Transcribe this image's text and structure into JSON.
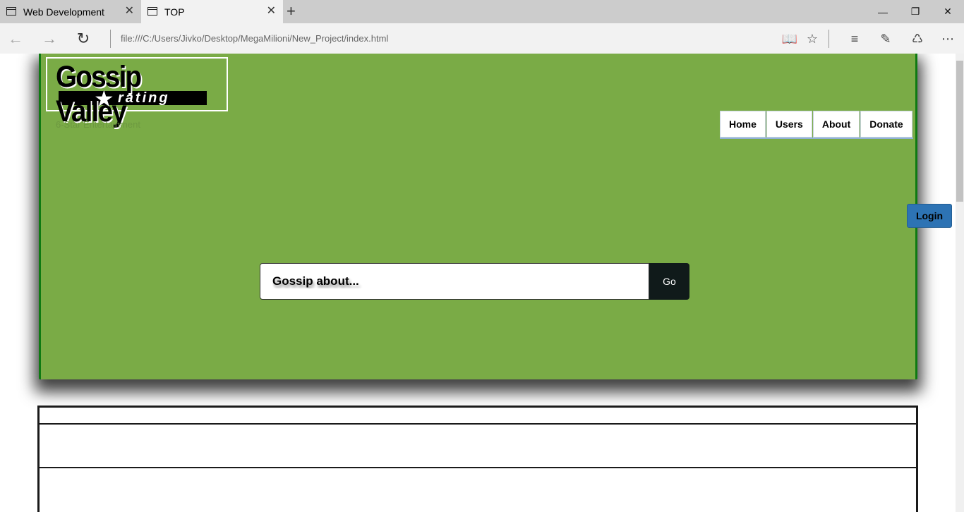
{
  "browser": {
    "tabs": [
      {
        "title": "Web Development",
        "active": false
      },
      {
        "title": "TOP",
        "active": true
      }
    ],
    "url": "file:///C:/Users/Jivko/Desktop/MegaMilioni/New_Project/index.html",
    "icons": {
      "back": "back-arrow-icon",
      "forward": "forward-arrow-icon",
      "refresh": "refresh-icon",
      "reading": "reading-view-icon",
      "favorite": "star-icon",
      "hub": "hub-icon",
      "note": "web-note-icon",
      "share": "share-icon",
      "more": "more-icon",
      "new_tab": "plus-icon",
      "close_tab": "close-icon"
    }
  },
  "site": {
    "logo": {
      "title": "Gossip Valley",
      "subtitle": "rating"
    },
    "tagline": "6-Star Entertainment",
    "nav": [
      "Home",
      "Users",
      "About",
      "Donate"
    ],
    "search": {
      "placeholder": "Gossip about...",
      "button": "Go"
    },
    "login": "Login",
    "colors": {
      "hero_bg": "#7aab46",
      "hero_border": "#0f7a12",
      "login_bg": "#2d73b4",
      "go_bg": "#101a1a"
    }
  }
}
